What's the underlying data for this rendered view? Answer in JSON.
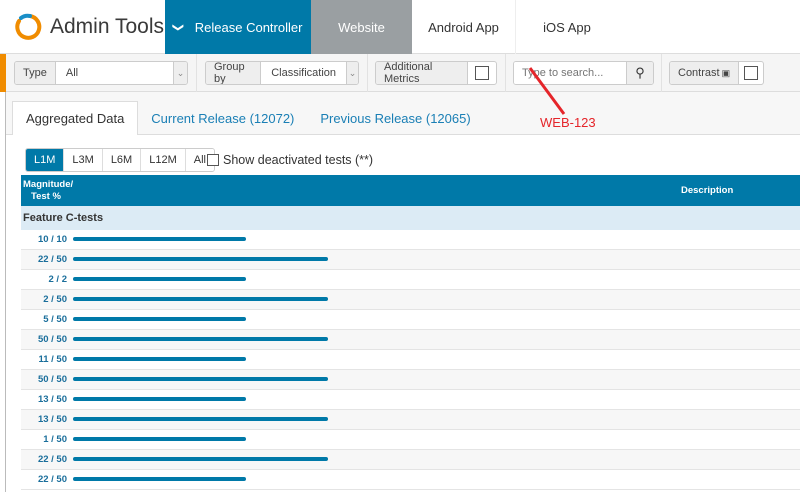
{
  "app": {
    "title": "Admin Tools"
  },
  "nav": [
    {
      "label": "Release Controller"
    },
    {
      "label": "Website"
    },
    {
      "label": "Android App"
    },
    {
      "label": "iOS App"
    }
  ],
  "toolbar": {
    "type_label": "Type",
    "type_value": "All",
    "group_label": "Group by",
    "group_value": "Classification",
    "metrics_label": "Additional Metrics",
    "search_placeholder": "Type to search...",
    "contrast_label": "Contrast"
  },
  "tabs": [
    {
      "label": "Aggregated Data"
    },
    {
      "label": "Current Release (12072)"
    },
    {
      "label": "Previous Release (12065)"
    }
  ],
  "periods": [
    {
      "label": "L1M"
    },
    {
      "label": "L3M"
    },
    {
      "label": "L6M"
    },
    {
      "label": "L12M"
    },
    {
      "label": "All"
    }
  ],
  "deactivated_label": "Show deactivated tests (**)",
  "table": {
    "col1": "Magnitude/",
    "col1b": "Test %",
    "col2": "Description",
    "group": "Feature C-tests",
    "rows": [
      {
        "label": "10 / 10",
        "bar": 0.68
      },
      {
        "label": "22 / 50",
        "bar": 1.0
      },
      {
        "label": "2 / 2",
        "bar": 0.68
      },
      {
        "label": "2 / 50",
        "bar": 1.0
      },
      {
        "label": "5 / 50",
        "bar": 0.68
      },
      {
        "label": "50 / 50",
        "bar": 1.0
      },
      {
        "label": "11 / 50",
        "bar": 0.68
      },
      {
        "label": "50 / 50",
        "bar": 1.0
      },
      {
        "label": "13 / 50",
        "bar": 0.68
      },
      {
        "label": "13 / 50",
        "bar": 1.0
      },
      {
        "label": "1 / 50",
        "bar": 0.68
      },
      {
        "label": "22 / 50",
        "bar": 1.0
      },
      {
        "label": "22 / 50",
        "bar": 0.68
      }
    ]
  },
  "annotation": "WEB-123",
  "colors": {
    "primary": "#0079a8",
    "accent": "#f08c00",
    "annotation": "#e5252a"
  }
}
